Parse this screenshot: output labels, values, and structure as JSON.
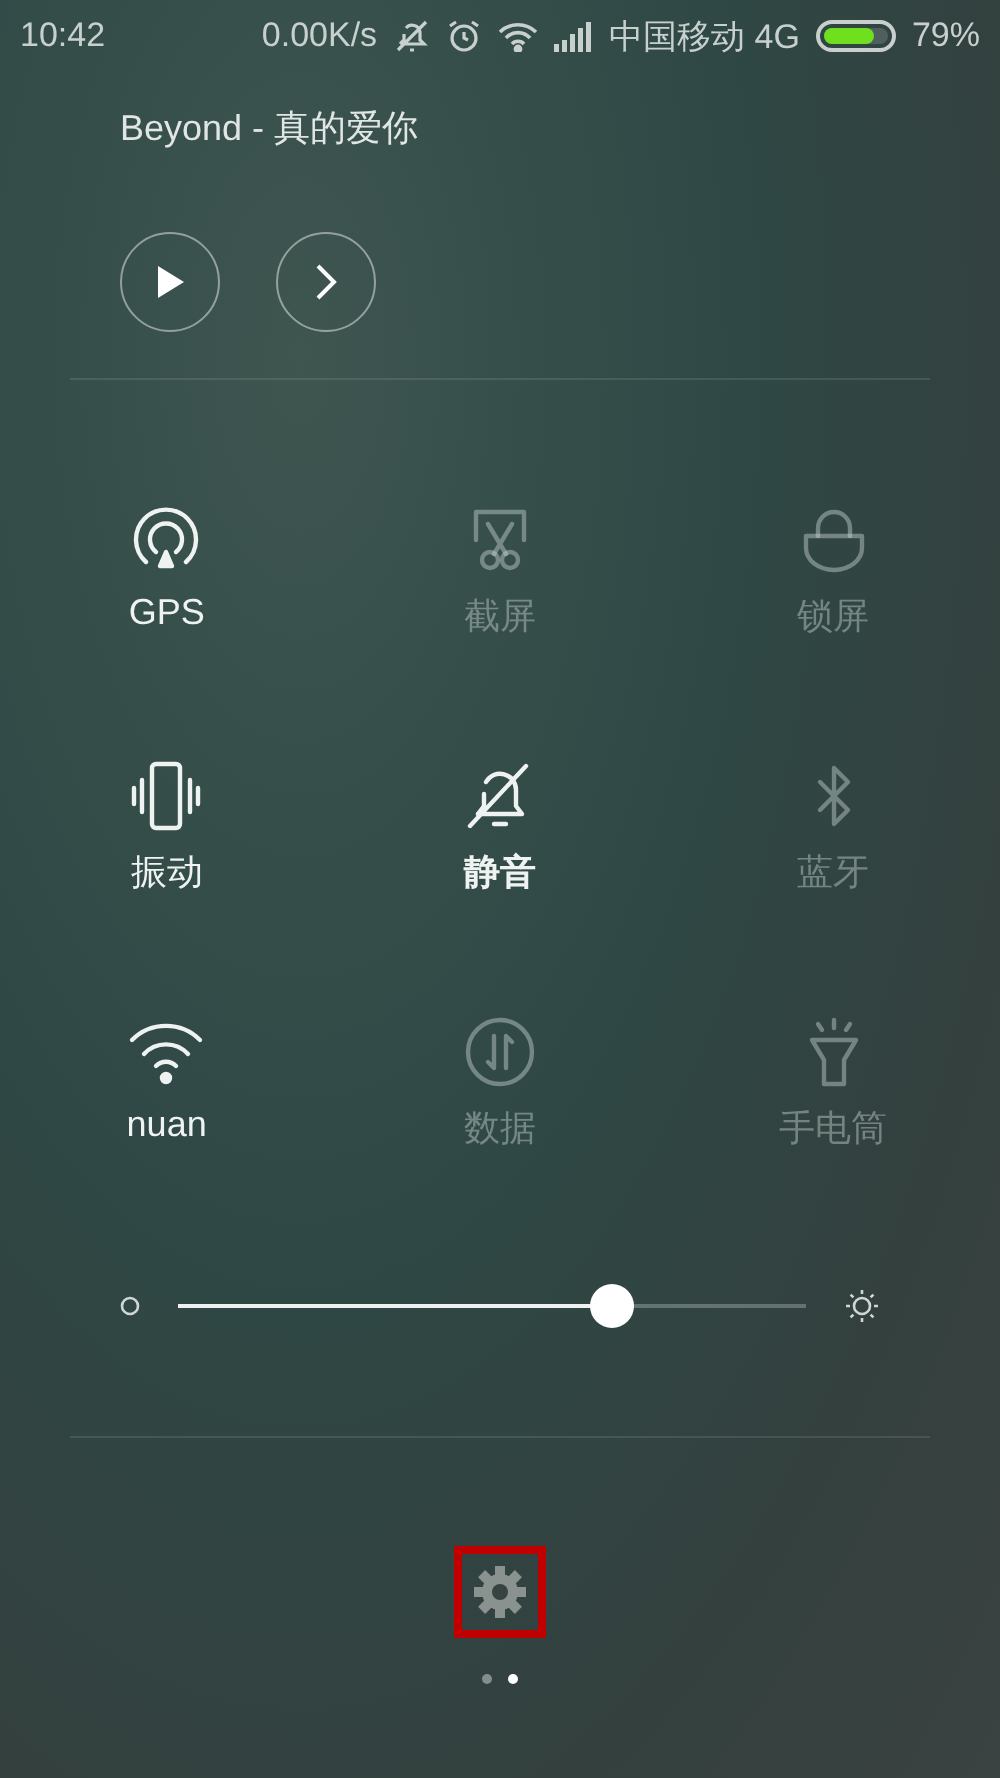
{
  "status_bar": {
    "time": "10:42",
    "net_speed": "0.00K/s",
    "carrier": "中国移动 4G",
    "battery": {
      "level": 0.79,
      "text": "79%"
    }
  },
  "media": {
    "title": "Beyond - 真的爱你",
    "controls": [
      {
        "kind": "play"
      },
      {
        "kind": "next"
      }
    ]
  },
  "tiles": [
    {
      "kind": "gps",
      "label": "GPS",
      "on": true
    },
    {
      "kind": "screenshot",
      "label": "截屏",
      "on": false
    },
    {
      "kind": "lock",
      "label": "锁屏",
      "on": false
    },
    {
      "kind": "vibrate",
      "label": "振动",
      "on": true
    },
    {
      "kind": "mute",
      "label": "静音",
      "on": true
    },
    {
      "kind": "bluetooth",
      "label": "蓝牙",
      "on": false
    },
    {
      "kind": "wifi",
      "label": "nuan",
      "on": true
    },
    {
      "kind": "data",
      "label": "数据",
      "on": false
    },
    {
      "kind": "torch",
      "label": "手电筒",
      "on": false
    }
  ],
  "brightness": {
    "level": 0.69
  },
  "settings": {
    "highlighted": true
  },
  "pager": [
    {
      "selected": false
    },
    {
      "selected": true
    }
  ]
}
